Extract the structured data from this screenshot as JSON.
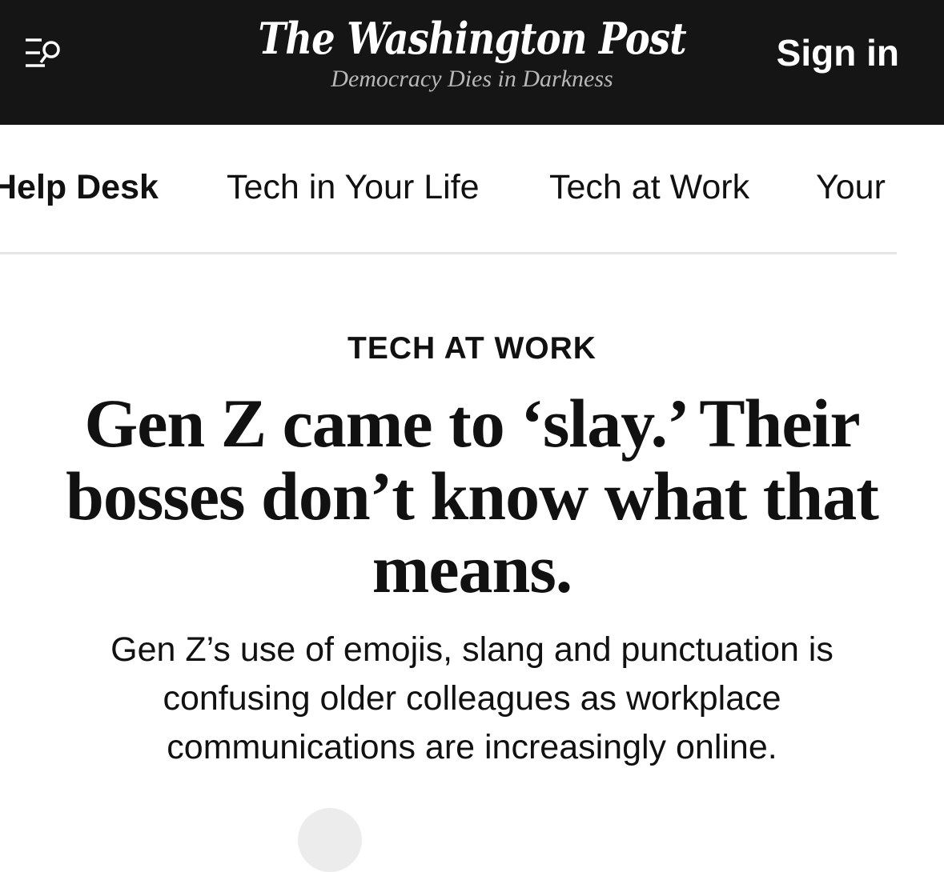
{
  "header": {
    "logo": "The Washington Post",
    "tagline": "Democracy Dies in Darkness",
    "sign_in_label": "Sign in",
    "menu_icon": "menu-search-icon",
    "background": "#151515"
  },
  "subnav": {
    "items": [
      {
        "label": "Help Desk",
        "active": true
      },
      {
        "label": "Tech in Your Life",
        "active": false
      },
      {
        "label": "Tech at Work",
        "active": false
      },
      {
        "label": "Your",
        "active": false
      }
    ]
  },
  "article": {
    "kicker": "TECH AT WORK",
    "headline": "Gen Z came to ‘slay.’ Their bosses don’t know what that means.",
    "dek": "Gen Z’s use of emojis, slang and punctuation is confusing older colleagues as workplace communications are increasingly online."
  }
}
